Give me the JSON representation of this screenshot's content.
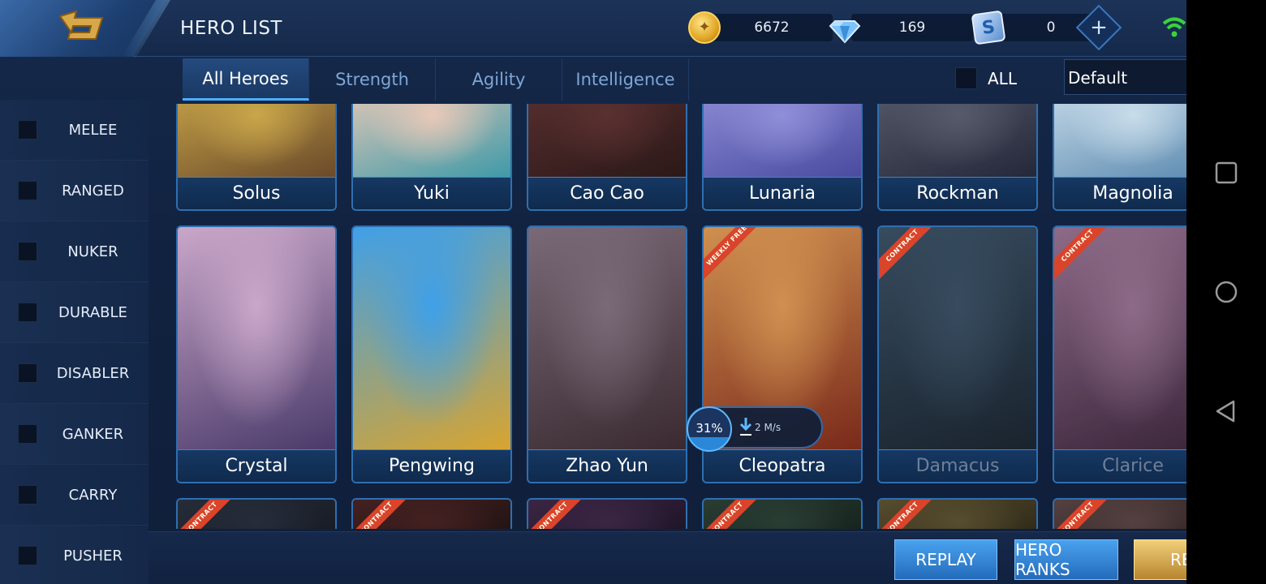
{
  "header": {
    "title": "HERO LIST"
  },
  "currencies": [
    {
      "icon": "gold-coin-icon",
      "value": "6672"
    },
    {
      "icon": "diamond-icon",
      "value": "169"
    },
    {
      "icon": "ticket-icon",
      "value": "0",
      "glyph": "S"
    }
  ],
  "plus_label": "+",
  "tabs": [
    {
      "label": "All Heroes",
      "active": true
    },
    {
      "label": "Strength",
      "active": false
    },
    {
      "label": "Agility",
      "active": false
    },
    {
      "label": "Intelligence",
      "active": false
    }
  ],
  "filter": {
    "all_label": "ALL",
    "sort_value": "Default"
  },
  "sidebar": {
    "items": [
      {
        "label": "MELEE"
      },
      {
        "label": "RANGED"
      },
      {
        "label": "NUKER"
      },
      {
        "label": "DURABLE"
      },
      {
        "label": "DISABLER"
      },
      {
        "label": "GANKER"
      },
      {
        "label": "CARRY"
      },
      {
        "label": "PUSHER"
      }
    ]
  },
  "heroes_row1": [
    {
      "name": "Solus",
      "palette": [
        "#c9a64a",
        "#6b4a2a"
      ]
    },
    {
      "name": "Yuki",
      "palette": [
        "#e8c9b8",
        "#3f9aa8"
      ]
    },
    {
      "name": "Cao Cao",
      "palette": [
        "#5a3030",
        "#2b1818"
      ]
    },
    {
      "name": "Lunaria",
      "palette": [
        "#8f8ed8",
        "#4a4ba0"
      ]
    },
    {
      "name": "Rockman",
      "palette": [
        "#565a6a",
        "#24283a"
      ]
    },
    {
      "name": "Magnolia",
      "palette": [
        "#c8dcea",
        "#5c8ab0"
      ]
    }
  ],
  "heroes_row2": [
    {
      "name": "Crystal",
      "palette": [
        "#c9a7c9",
        "#4a3a6a"
      ],
      "ribbon": "",
      "locked": false
    },
    {
      "name": "Pengwing",
      "palette": [
        "#3fa0e8",
        "#d8a430"
      ],
      "ribbon": "",
      "locked": false
    },
    {
      "name": "Zhao Yun",
      "palette": [
        "#7a6a78",
        "#3a2a30"
      ],
      "ribbon": "",
      "locked": false
    },
    {
      "name": "Cleopatra",
      "palette": [
        "#d09050",
        "#7a2a1a"
      ],
      "ribbon": "WEEKLY FREE",
      "locked": false
    },
    {
      "name": "Damacus",
      "palette": [
        "#3a5a78",
        "#1a2a3a"
      ],
      "ribbon": "CONTRACT",
      "locked": true
    },
    {
      "name": "Clarice",
      "palette": [
        "#b07aa8",
        "#4a2a4a"
      ],
      "ribbon": "CONTRACT",
      "locked": true
    }
  ],
  "heroes_row3": [
    {
      "ribbon": "CONTRACT",
      "palette": [
        "#2a3448",
        "#141a28"
      ]
    },
    {
      "ribbon": "CONTRACT",
      "palette": [
        "#5a2424",
        "#201010"
      ]
    },
    {
      "ribbon": "CONTRACT",
      "palette": [
        "#4a2a5a",
        "#1a1028"
      ]
    },
    {
      "ribbon": "CONTRACT",
      "palette": [
        "#2a4a3a",
        "#10201a"
      ]
    },
    {
      "ribbon": "CONTRACT",
      "palette": [
        "#6a5a2a",
        "#2a2410"
      ]
    },
    {
      "ribbon": "CONTRACT",
      "palette": [
        "#6a4a4a",
        "#2a1a1a"
      ]
    }
  ],
  "download": {
    "percent": "31%",
    "speed": "2 M/s",
    "progress": 0.31
  },
  "buttons": {
    "replay": "REPLAY",
    "hero_ranks": "HERO RANKS",
    "third": "RE"
  }
}
